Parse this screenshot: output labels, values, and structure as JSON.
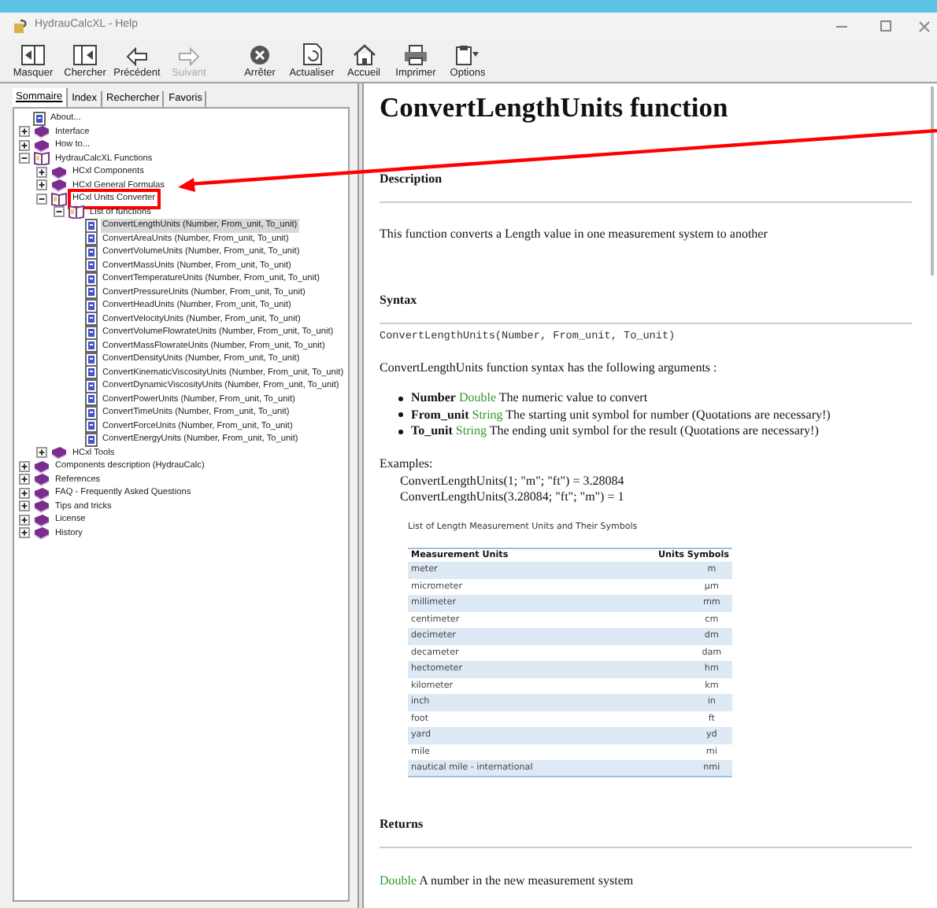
{
  "window": {
    "title": "HydrauCalcXL - Help"
  },
  "toolbar": [
    {
      "label": "Masquer",
      "disabled": false
    },
    {
      "label": "Chercher",
      "disabled": false
    },
    {
      "label": "Précédent",
      "disabled": false
    },
    {
      "label": "Suivant",
      "disabled": true
    },
    {
      "label": "Arrêter",
      "disabled": false
    },
    {
      "label": "Actualiser",
      "disabled": false
    },
    {
      "label": "Accueil",
      "disabled": false
    },
    {
      "label": "Imprimer",
      "disabled": false
    },
    {
      "label": "Options",
      "disabled": false
    }
  ],
  "tabs": [
    {
      "label": "Sommaire",
      "selected": true
    },
    {
      "label": "Index",
      "selected": false
    },
    {
      "label": "Rechercher",
      "selected": false
    },
    {
      "label": "Favoris",
      "selected": false
    }
  ],
  "tree": [
    {
      "label": "About...",
      "kind": "page",
      "selected": false
    },
    {
      "label": "Interface",
      "kind": "book",
      "expanded": false
    },
    {
      "label": "How to...",
      "kind": "book",
      "expanded": false
    },
    {
      "label": "HydrauCalcXL Functions",
      "kind": "book",
      "expanded": true,
      "children": [
        {
          "label": "HCxl Components",
          "kind": "book",
          "expanded": false
        },
        {
          "label": "HCxl General Formulas",
          "kind": "book",
          "expanded": false
        },
        {
          "label": "HCxl Units Converter",
          "kind": "book",
          "expanded": true,
          "highlighted": true,
          "children": [
            {
              "label": "List of functions",
              "kind": "book",
              "expanded": true,
              "children": [
                {
                  "label": "ConvertLengthUnits (Number, From_unit, To_unit)",
                  "kind": "page",
                  "selected": true
                },
                {
                  "label": "ConvertAreaUnits (Number, From_unit, To_unit)",
                  "kind": "page",
                  "selected": false
                },
                {
                  "label": "ConvertVolumeUnits (Number, From_unit, To_unit)",
                  "kind": "page",
                  "selected": false
                },
                {
                  "label": "ConvertMassUnits (Number, From_unit, To_unit)",
                  "kind": "page",
                  "selected": false
                },
                {
                  "label": "ConvertTemperatureUnits (Number, From_unit, To_unit)",
                  "kind": "page",
                  "selected": false
                },
                {
                  "label": "ConvertPressureUnits (Number, From_unit, To_unit)",
                  "kind": "page",
                  "selected": false
                },
                {
                  "label": "ConvertHeadUnits (Number, From_unit, To_unit)",
                  "kind": "page",
                  "selected": false
                },
                {
                  "label": "ConvertVelocityUnits (Number, From_unit, To_unit)",
                  "kind": "page",
                  "selected": false
                },
                {
                  "label": "ConvertVolumeFlowrateUnits (Number, From_unit, To_unit)",
                  "kind": "page",
                  "selected": false
                },
                {
                  "label": "ConvertMassFlowrateUnits (Number, From_unit, To_unit)",
                  "kind": "page",
                  "selected": false
                },
                {
                  "label": "ConvertDensityUnits (Number, From_unit, To_unit)",
                  "kind": "page",
                  "selected": false
                },
                {
                  "label": "ConvertKinematicViscosityUnits (Number, From_unit, To_unit)",
                  "kind": "page",
                  "selected": false
                },
                {
                  "label": "ConvertDynamicViscosityUnits (Number, From_unit, To_unit)",
                  "kind": "page",
                  "selected": false
                },
                {
                  "label": "ConvertPowerUnits (Number, From_unit, To_unit)",
                  "kind": "page",
                  "selected": false
                },
                {
                  "label": "ConvertTimeUnits (Number, From_unit, To_unit)",
                  "kind": "page",
                  "selected": false
                },
                {
                  "label": "ConvertForceUnits (Number, From_unit, To_unit)",
                  "kind": "page",
                  "selected": false
                },
                {
                  "label": "ConvertEnergyUnits (Number, From_unit, To_unit)",
                  "kind": "page",
                  "selected": false
                }
              ]
            }
          ]
        },
        {
          "label": "HCxl Tools",
          "kind": "book",
          "expanded": false
        }
      ]
    },
    {
      "label": "Components description (HydrauCalc)",
      "kind": "book",
      "expanded": false
    },
    {
      "label": "References",
      "kind": "book",
      "expanded": false
    },
    {
      "label": "FAQ - Frequently Asked Questions",
      "kind": "book",
      "expanded": false
    },
    {
      "label": "Tips and tricks",
      "kind": "book",
      "expanded": false
    },
    {
      "label": "License",
      "kind": "book",
      "expanded": false
    },
    {
      "label": "History",
      "kind": "book",
      "expanded": false
    }
  ],
  "content": {
    "title": "ConvertLengthUnits function",
    "description_heading": "Description",
    "description": "This function converts a Length value in one measurement system to another",
    "syntax_heading": "Syntax",
    "syntax_code": "ConvertLengthUnits(Number, From_unit, To_unit)",
    "syntax_intro": "ConvertLengthUnits function syntax has the following arguments :",
    "arguments": [
      {
        "name": "Number",
        "type": "Double",
        "text": "The numeric value to convert"
      },
      {
        "name": "From_unit",
        "type": "String",
        "text": "The starting unit symbol for number (Quotations are necessary!)"
      },
      {
        "name": "To_unit",
        "type": "String",
        "text": "The ending unit symbol for the result (Quotations are necessary!)"
      }
    ],
    "examples_label": "Examples:",
    "examples": [
      "ConvertLengthUnits(1; \"m\"; \"ft\") = 3.28084",
      "ConvertLengthUnits(3.28084; \"ft\"; \"m\") = 1"
    ],
    "table_caption": "List of Length Measurement Units and Their Symbols",
    "table_columns": [
      "Measurement Units",
      "Units Symbols"
    ],
    "table_rows": [
      [
        "meter",
        "m"
      ],
      [
        "micrometer",
        "µm"
      ],
      [
        "millimeter",
        "mm"
      ],
      [
        "centimeter",
        "cm"
      ],
      [
        "decimeter",
        "dm"
      ],
      [
        "decameter",
        "dam"
      ],
      [
        "hectometer",
        "hm"
      ],
      [
        "kilometer",
        "km"
      ],
      [
        "inch",
        "in"
      ],
      [
        "foot",
        "ft"
      ],
      [
        "yard",
        "yd"
      ],
      [
        "mile",
        "mi"
      ],
      [
        "nautical mile - international",
        "nmi"
      ]
    ],
    "returns_heading": "Returns",
    "returns_type": "Double",
    "returns_text": "A number in the new measurement system"
  }
}
